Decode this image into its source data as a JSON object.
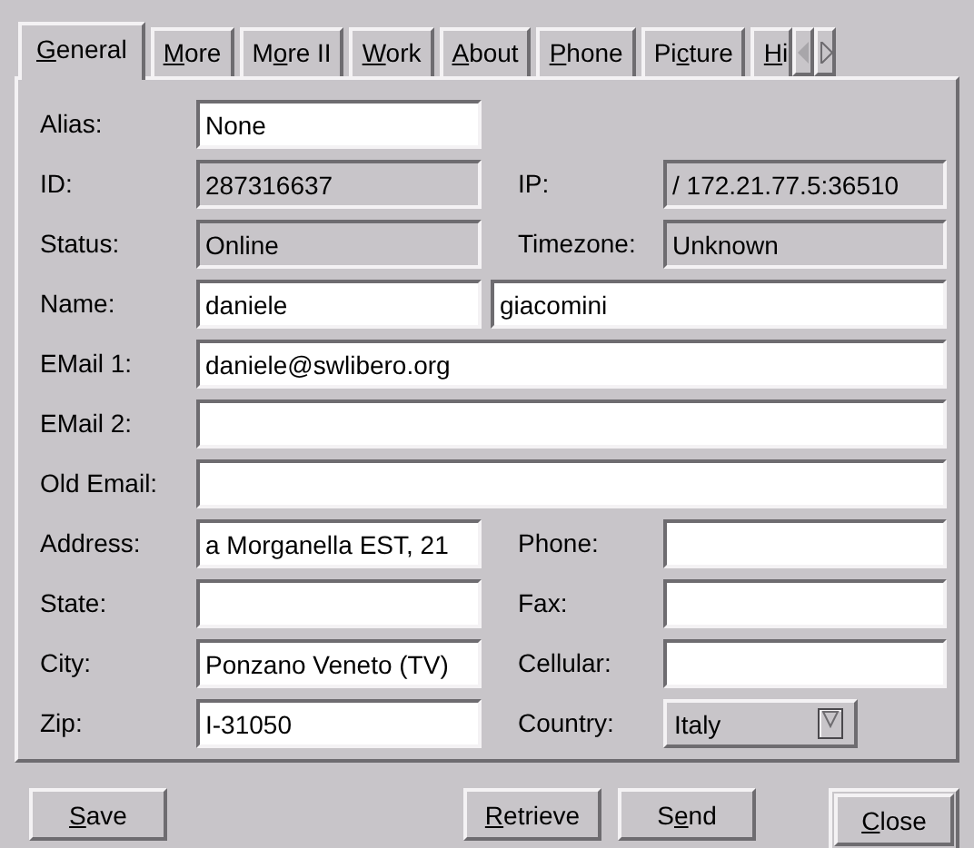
{
  "tabs": [
    {
      "label": {
        "key": "G",
        "after": "eneral"
      },
      "selected": true
    },
    {
      "label": {
        "key": "M",
        "after": "ore"
      },
      "selected": false
    },
    {
      "label": {
        "before": "M",
        "key": "o",
        "after": "re II"
      },
      "selected": false
    },
    {
      "label": {
        "key": "W",
        "after": "ork"
      },
      "selected": false
    },
    {
      "label": {
        "key": "A",
        "after": "bout"
      },
      "selected": false
    },
    {
      "label": {
        "key": "P",
        "after": "hone"
      },
      "selected": false
    },
    {
      "label": {
        "before": "Pi",
        "key": "c",
        "after": "ture"
      },
      "selected": false
    },
    {
      "label": {
        "key": "H",
        "after": "i"
      },
      "selected": false
    }
  ],
  "rows": [
    {
      "cells": [
        {
          "kind": "label",
          "text": "Alias:"
        },
        {
          "kind": "entry",
          "value": "None"
        }
      ]
    },
    {
      "cells": [
        {
          "kind": "label",
          "text": "ID:"
        },
        {
          "kind": "readonly",
          "value": "287316637"
        },
        {
          "kind": "label",
          "text": "IP:"
        },
        {
          "kind": "readonly",
          "value": "/ 172.21.77.5:36510"
        }
      ]
    },
    {
      "cells": [
        {
          "kind": "label",
          "text": "Status:"
        },
        {
          "kind": "readonly",
          "value": "Online"
        },
        {
          "kind": "label",
          "text": "Timezone:"
        },
        {
          "kind": "readonly",
          "value": "Unknown"
        }
      ]
    },
    {
      "cells": [
        {
          "kind": "label",
          "text": "Name:"
        },
        {
          "kind": "entry",
          "value": "daniele"
        },
        {
          "kind": "rest",
          "value": "giacomini"
        }
      ]
    },
    {
      "cells": [
        {
          "kind": "label",
          "text": "EMail 1:"
        },
        {
          "kind": "wide",
          "value": "daniele@swlibero.org"
        }
      ]
    },
    {
      "cells": [
        {
          "kind": "label",
          "text": "EMail 2:"
        },
        {
          "kind": "wide"
        }
      ]
    },
    {
      "cells": [
        {
          "kind": "label",
          "text": "Old Email:"
        },
        {
          "kind": "wide"
        }
      ]
    },
    {
      "cells": [
        {
          "kind": "label",
          "text": "Address:"
        },
        {
          "kind": "entry",
          "value": "a Morganella EST, 21"
        },
        {
          "kind": "label",
          "text": "Phone:"
        },
        {
          "kind": "entry"
        }
      ]
    },
    {
      "cells": [
        {
          "kind": "label",
          "text": "State:"
        },
        {
          "kind": "entry"
        },
        {
          "kind": "label",
          "text": "Fax:"
        },
        {
          "kind": "entry"
        }
      ]
    },
    {
      "cells": [
        {
          "kind": "label",
          "text": "City:"
        },
        {
          "kind": "entry",
          "value": "Ponzano Veneto (TV)"
        },
        {
          "kind": "label",
          "text": "Cellular:"
        },
        {
          "kind": "entry"
        }
      ]
    },
    {
      "cells": [
        {
          "kind": "label",
          "text": "Zip:"
        },
        {
          "kind": "entry",
          "value": "I-31050"
        },
        {
          "kind": "label",
          "text": "Country:"
        },
        {
          "kind": "combo",
          "value": "Italy"
        }
      ]
    }
  ],
  "buttons": [
    {
      "label": {
        "key": "S",
        "after": "ave"
      },
      "is_default": false
    },
    {
      "label": {
        "key": "R",
        "after": "etrieve"
      },
      "is_default": false
    },
    {
      "label": {
        "before": "S",
        "key": "e",
        "after": "nd"
      },
      "is_default": false
    },
    {
      "label": {
        "key": "C",
        "after": "lose"
      },
      "is_default": true
    }
  ]
}
